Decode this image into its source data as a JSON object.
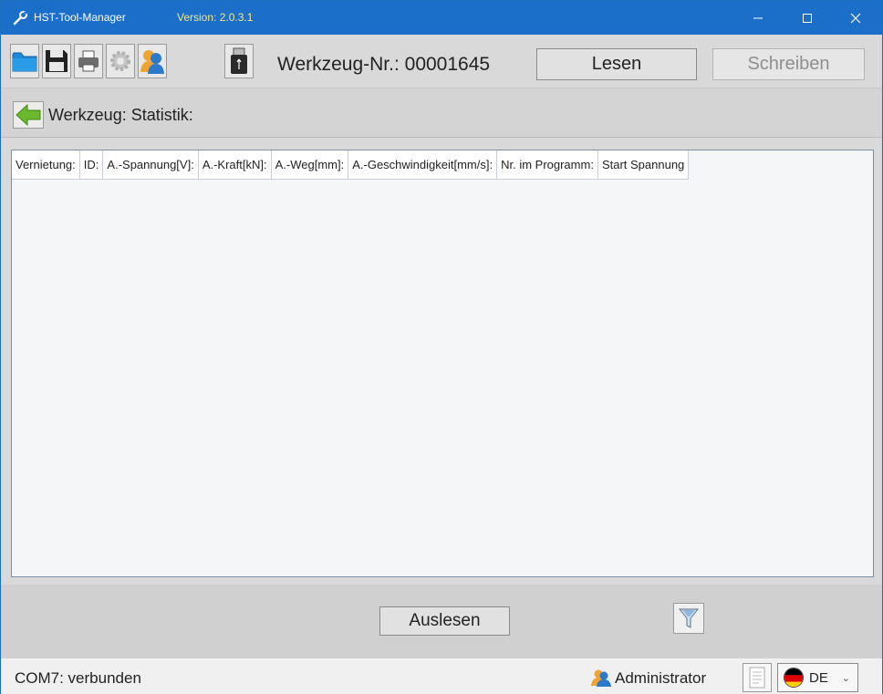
{
  "window": {
    "title": "HST-Tool-Manager",
    "version": "Version: 2.0.3.1",
    "accent_color": "#1b6fc9",
    "controls": {
      "minimize": "minimize-icon",
      "maximize": "maximize-icon",
      "close": "close-icon"
    }
  },
  "toolbar": {
    "icons": [
      "folder-open-icon",
      "save-icon",
      "printer-icon",
      "gear-icon",
      "users-icon",
      "usb-stick-icon"
    ],
    "tool_number": "Werkzeug-Nr.: 00001645",
    "read_label": "Lesen",
    "write_label": "Schreiben"
  },
  "section": {
    "title": "Werkzeug: Statistik:"
  },
  "table": {
    "columns": [
      "Vernietung:",
      "ID:",
      "A.-Spannung[V]:",
      "A.-Kraft[kN]:",
      "A.-Weg[mm]:",
      "A.-Geschwindigkeit[mm/s]:",
      "Nr. im Programm:",
      "Start Spannung"
    ],
    "rows": []
  },
  "actions": {
    "readout_label": "Auslesen"
  },
  "status": {
    "connection": "COM7: verbunden",
    "user": "Administrator",
    "language": "DE"
  }
}
